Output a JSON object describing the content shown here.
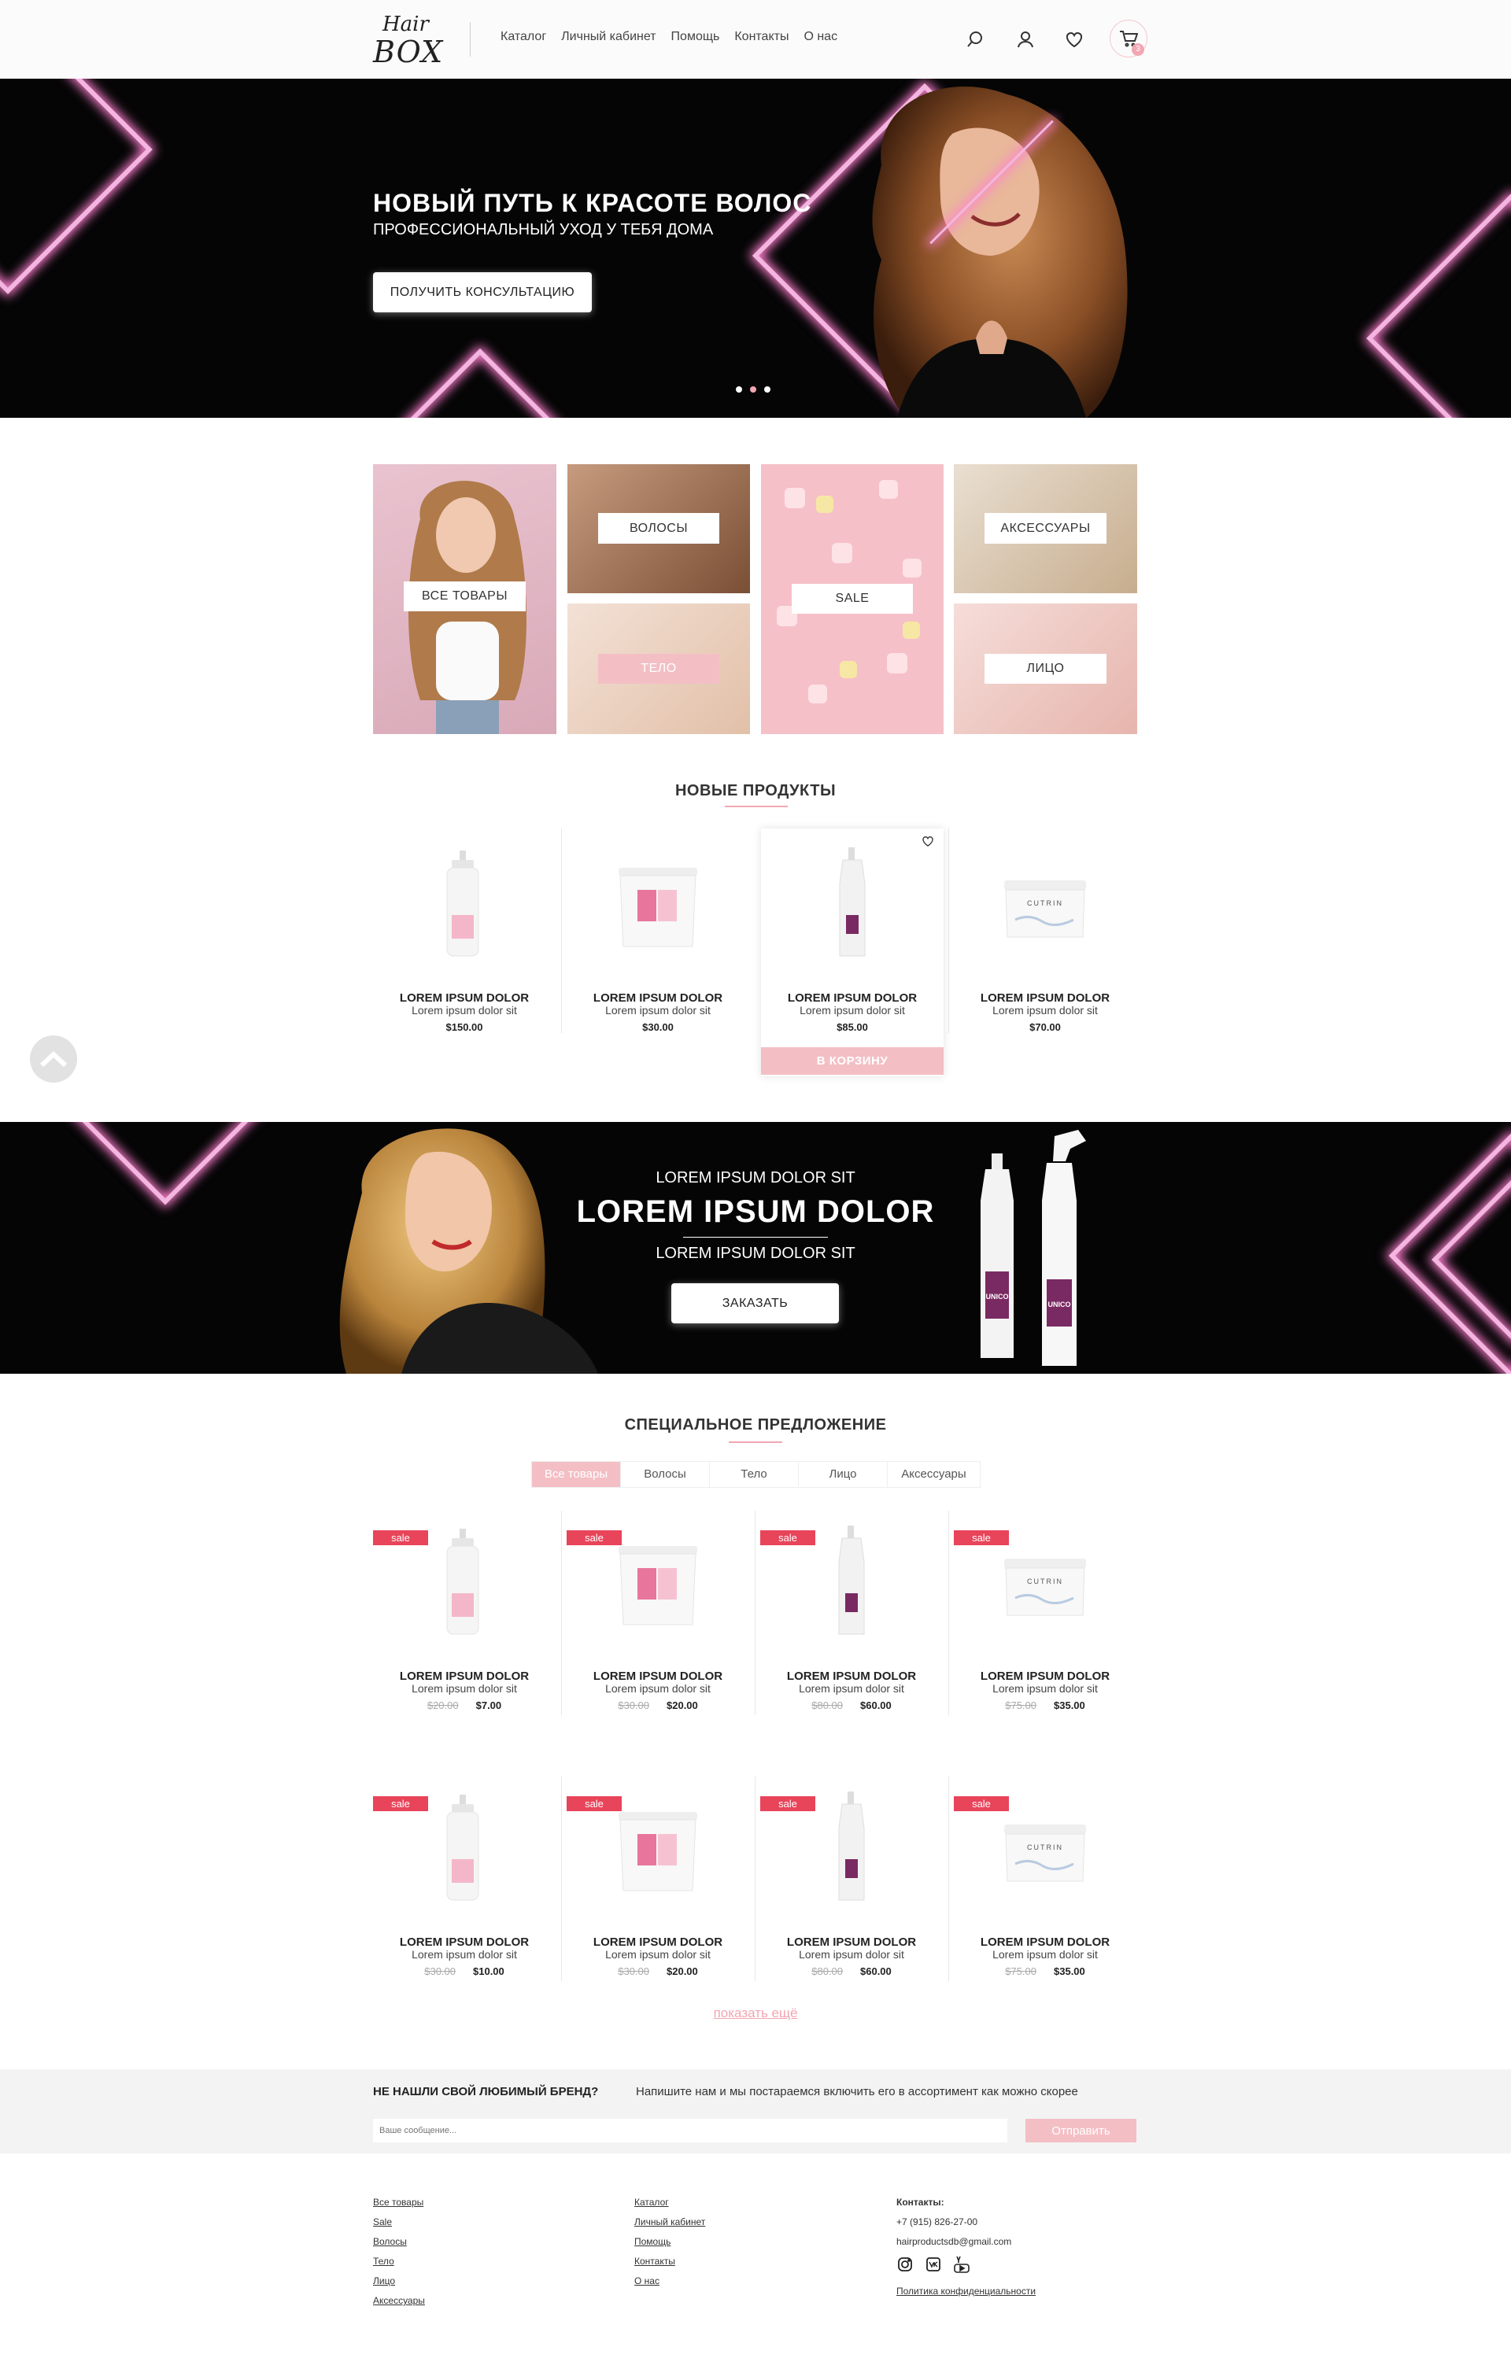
{
  "header": {
    "logo_top": "Hair",
    "logo_bottom": "BOX",
    "nav": [
      "Каталог",
      "Личный кабинет",
      "Помощь",
      "Контакты",
      "О нас"
    ],
    "cart_count": "3"
  },
  "hero": {
    "title": "НОВЫЙ ПУТЬ К КРАСОТЕ ВОЛОС",
    "subtitle": "ПРОФЕССИОНАЛЬНЫЙ УХОД У ТЕБЯ ДОМА",
    "button": "ПОЛУЧИТЬ КОНСУЛЬТАЦИЮ",
    "slides": 3,
    "active_slide": 2
  },
  "categories": {
    "all": "ВСЕ ТОВАРЫ",
    "hair": "ВОЛОСЫ",
    "body": "ТЕЛО",
    "sale": "SALE",
    "accessories": "АКСЕССУАРЫ",
    "face": "ЛИЦО"
  },
  "new_products": {
    "title": "НОВЫЕ ПРОДУКТЫ",
    "add_to_cart": "В КОРЗИНУ",
    "items": [
      {
        "name": "LOREM IPSUM DOLOR",
        "sub": "Lorem ipsum dolor sit",
        "price": "$150.00",
        "image": "pump-bottle-icon"
      },
      {
        "name": "LOREM IPSUM DOLOR",
        "sub": "Lorem ipsum dolor sit",
        "price": "$30.00",
        "image": "jar-icon"
      },
      {
        "name": "LOREM IPSUM DOLOR",
        "sub": "Lorem ipsum dolor sit",
        "price": "$85.00",
        "image": "tall-bottle-icon"
      },
      {
        "name": "LOREM IPSUM DOLOR",
        "sub": "Lorem ipsum dolor sit",
        "price": "$70.00",
        "image": "cutrin-jar-icon"
      }
    ]
  },
  "promo": {
    "line1": "LOREM IPSUM DOLOR SIT",
    "headline": "LOREM IPSUM DOLOR",
    "line2": "LOREM IPSUM DOLOR SIT",
    "button": "ЗАКАЗАТЬ",
    "product_brand": "UNICO"
  },
  "special": {
    "title": "СПЕЦИАЛЬНОЕ ПРЕДЛОЖЕНИЕ",
    "tabs": [
      "Все товары",
      "Волосы",
      "Тело",
      "Лицо",
      "Аксессуары"
    ],
    "active_tab": 0,
    "sale_label": "sale",
    "rows": [
      [
        {
          "name": "LOREM IPSUM DOLOR",
          "sub": "Lorem ipsum dolor sit",
          "old": "$20.00",
          "price": "$7.00"
        },
        {
          "name": "LOREM IPSUM DOLOR",
          "sub": "Lorem ipsum dolor sit",
          "old": "$30.00",
          "price": "$20.00"
        },
        {
          "name": "LOREM IPSUM DOLOR",
          "sub": "Lorem ipsum dolor sit",
          "old": "$80.00",
          "price": "$60.00"
        },
        {
          "name": "LOREM IPSUM DOLOR",
          "sub": "Lorem ipsum dolor sit",
          "old": "$75.00",
          "price": "$35.00"
        }
      ],
      [
        {
          "name": "LOREM IPSUM DOLOR",
          "sub": "Lorem ipsum dolor sit",
          "old": "$30.00",
          "price": "$10.00"
        },
        {
          "name": "LOREM IPSUM DOLOR",
          "sub": "Lorem ipsum dolor sit",
          "old": "$30.00",
          "price": "$20.00"
        },
        {
          "name": "LOREM IPSUM DOLOR",
          "sub": "Lorem ipsum dolor sit",
          "old": "$80.00",
          "price": "$60.00"
        },
        {
          "name": "LOREM IPSUM DOLOR",
          "sub": "Lorem ipsum dolor sit",
          "old": "$75.00",
          "price": "$35.00"
        }
      ]
    ],
    "more": "показать ещё"
  },
  "brand": {
    "question": "НЕ НАШЛИ СВОЙ ЛЮБИМЫЙ БРЕНД?",
    "text": "Напишите нам и мы постараемся включить его в ассортимент как можно скорее",
    "placeholder": "Ваше сообщение...",
    "button": "Отправить"
  },
  "footer": {
    "col1": [
      "Все товары",
      "Sale",
      "Волосы",
      "Тело",
      "Лицо",
      "Аксессуары"
    ],
    "col2": [
      "Каталог",
      "Личный кабинет",
      "Помощь",
      "Контакты",
      "О нас"
    ],
    "contacts_title": "Контакты:",
    "phone": "+7 (915) 826-27-00",
    "email": "hairproductsdb@gmail.com",
    "privacy": "Политика конфиденциальности"
  },
  "colors": {
    "accent": "#f1a7b3",
    "sale": "#e8445a",
    "neon": "#f4b5e0",
    "dark": "#050505"
  }
}
